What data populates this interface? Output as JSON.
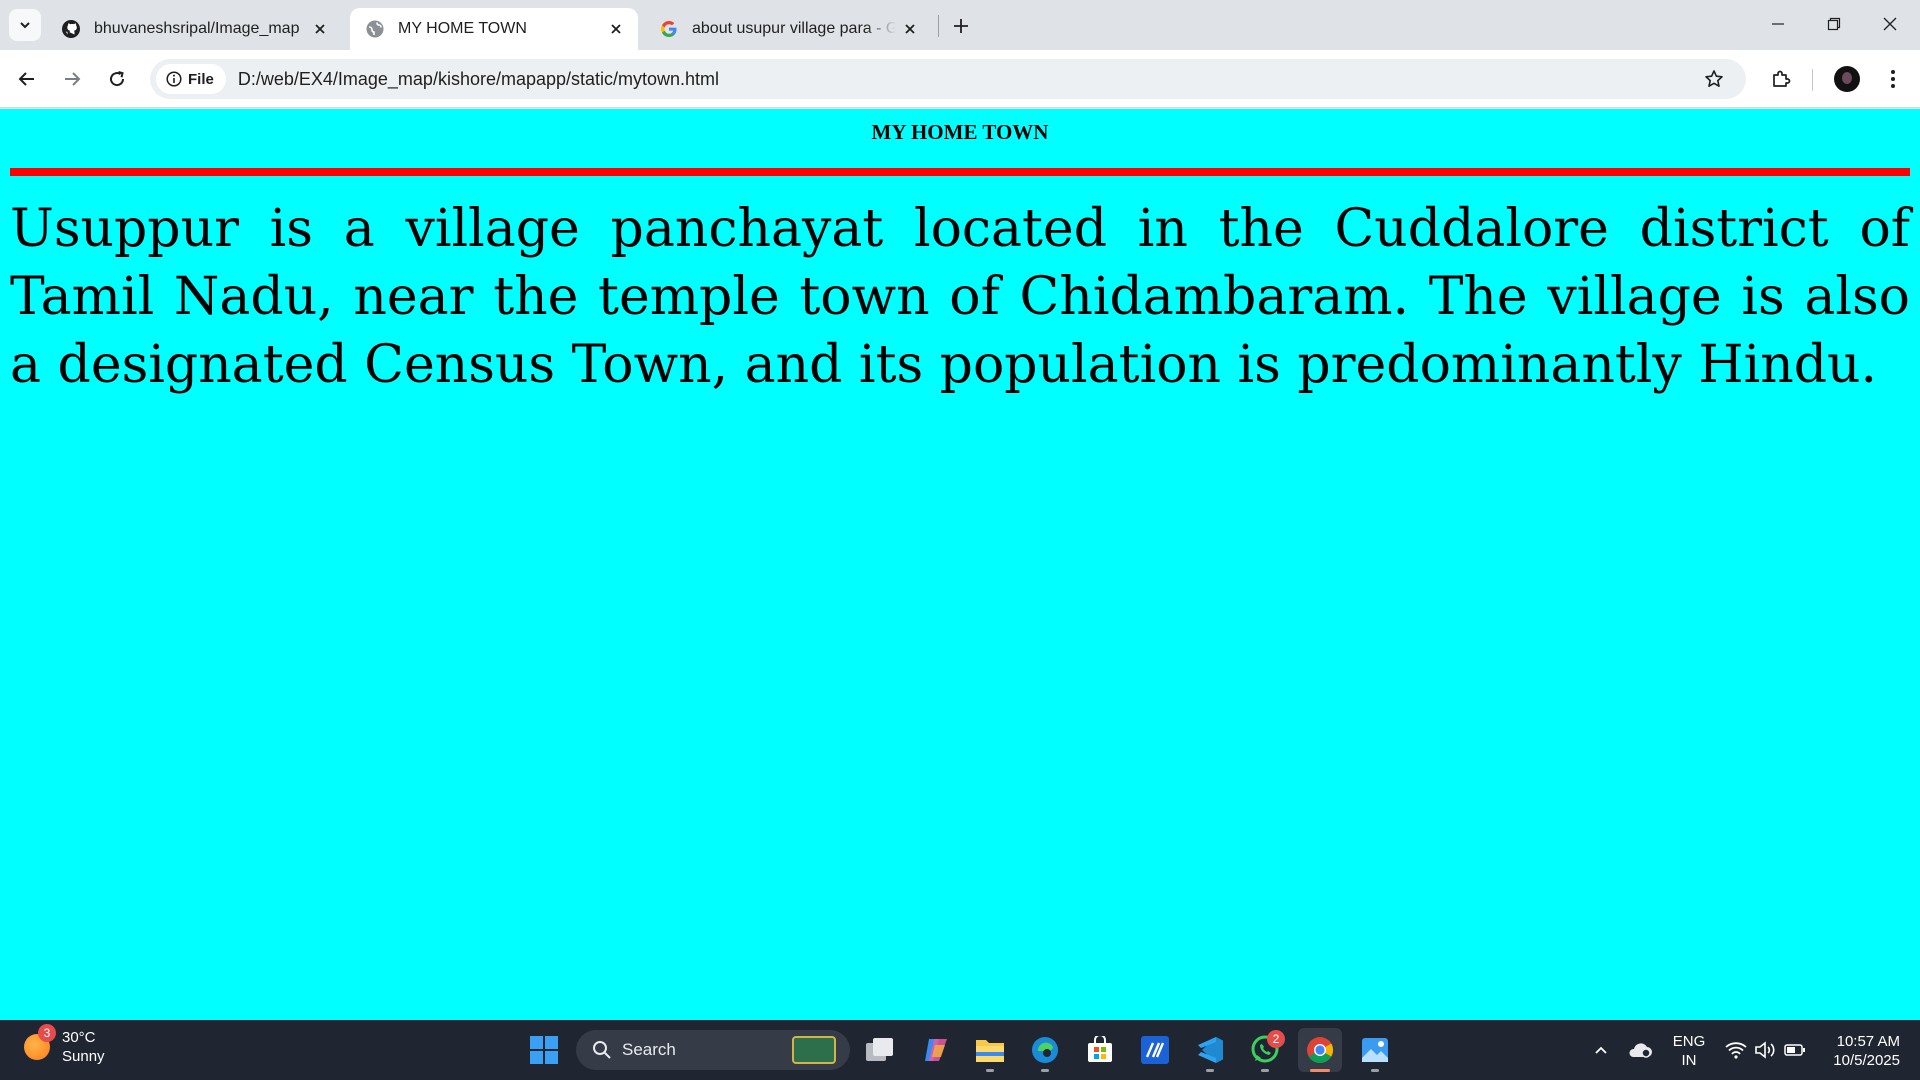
{
  "browser": {
    "tabs": [
      {
        "title": "bhuvaneshsripal/Image_map",
        "icon": "github-icon",
        "active": false
      },
      {
        "title": "MY HOME TOWN",
        "icon": "globe-icon",
        "active": true
      },
      {
        "title": "about usupur village para - Google Search",
        "icon": "google-icon",
        "active": false
      }
    ],
    "site_chip_label": "File",
    "url": "D:/web/EX4/Image_map/kishore/mapapp/static/mytown.html"
  },
  "page": {
    "heading": "MY HOME TOWN",
    "paragraph": "Usuppur is a village panchayat located in the Cuddalore district of Tamil Nadu, near the temple town of Chidambaram. The village is also a designated Census Town, and its population is predominantly Hindu.",
    "background_color": "#00ffff",
    "rule_color": "#ff0000"
  },
  "taskbar": {
    "weather_badge": "3",
    "temperature": "30°C",
    "condition": "Sunny",
    "search_label": "Search",
    "whatsapp_badge": "2",
    "language": "ENG",
    "region": "IN",
    "time": "10:57 AM",
    "date": "10/5/2025"
  }
}
